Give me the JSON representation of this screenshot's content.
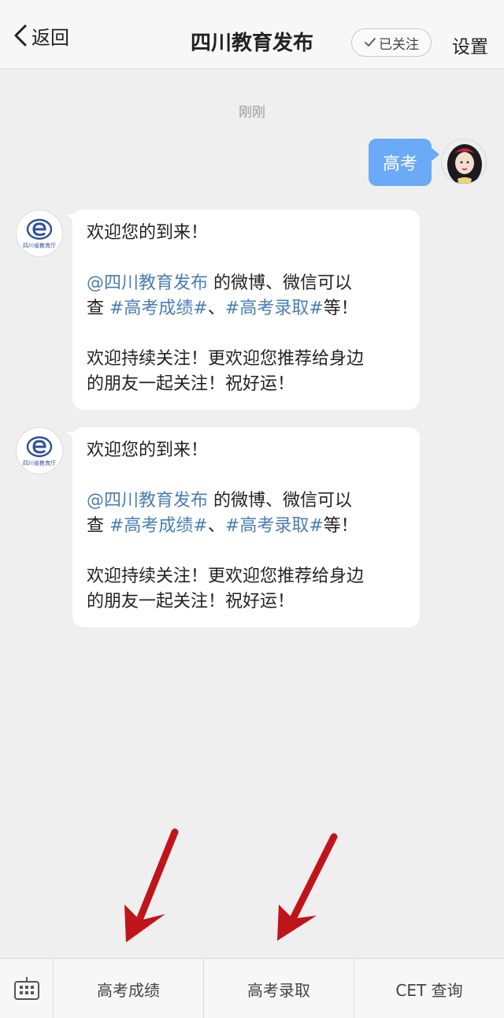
{
  "header": {
    "back_label": "返回",
    "title": "四川教育发布",
    "follow_label": "已关注",
    "settings_label": "设置"
  },
  "chat": {
    "timestamp": "刚刚",
    "my_message": "高考",
    "avatar_logo_text": "四川省教育厅",
    "replies": [
      {
        "line1": "欢迎您的到来！",
        "mention": "@四川教育发布",
        "line2_rest": " 的微博、微信可以",
        "line3_prefix": "查 ",
        "hashtag1": "#高考成绩#",
        "sep": "、",
        "hashtag2": "#高考录取#",
        "line3_suffix": "等！",
        "line4": "欢迎持续关注！更欢迎您推荐给身边",
        "line5": "的朋友一起关注！祝好运！"
      },
      {
        "line1": "欢迎您的到来！",
        "mention": "@四川教育发布",
        "line2_rest": " 的微博、微信可以",
        "line3_prefix": "查 ",
        "hashtag1": "#高考成绩#",
        "sep": "、",
        "hashtag2": "#高考录取#",
        "line3_suffix": "等！",
        "line4": "欢迎持续关注！更欢迎您推荐给身边",
        "line5": "的朋友一起关注！祝好运！"
      }
    ]
  },
  "bottom_menu": {
    "keyboard_icon": "keyboard-icon",
    "items": [
      "高考成绩",
      "高考录取",
      "CET 查询"
    ]
  },
  "colors": {
    "link": "#4a7db6",
    "my_bubble": "#6aaaf7",
    "annotation_arrow": "#c0141b"
  }
}
